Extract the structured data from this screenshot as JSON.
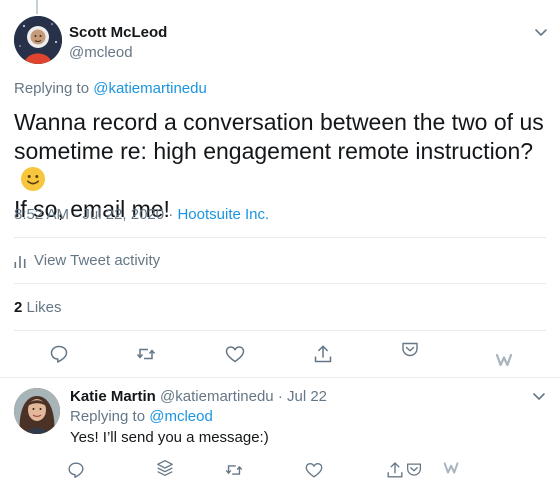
{
  "tweet": {
    "author_name": "Scott McLeod",
    "author_handle": "@mcleod",
    "replying_prefix": "Replying to ",
    "replying_to": "@katiemartinedu",
    "text_lines": [
      "Wanna record a conversation between the two of us",
      "sometime re: high engagement remote instruction?",
      "If so, email me!"
    ],
    "time": "8:52 AM",
    "date": "Jul 22, 2020",
    "separator": " · ",
    "source": "Hootsuite Inc.",
    "activity_label": "View Tweet activity",
    "likes_count": "2",
    "likes_label": " Likes"
  },
  "reply": {
    "author_name": "Katie Martin",
    "author_handle": "@katiemartinedu",
    "dot": " · ",
    "date": "Jul 22",
    "replying_prefix": "Replying to ",
    "replying_to": "@mcleod",
    "text": "Yes! I’ll send you a message:)"
  },
  "icons": {
    "reply": "reply-icon",
    "retweet": "retweet-icon",
    "like": "heart-icon",
    "share": "share-icon",
    "pocket": "pocket-icon",
    "w": "w-extension-icon",
    "layers": "layers-icon",
    "caret": "chevron-down-icon",
    "activity": "bar-chart-icon"
  },
  "colors": {
    "link": "#1b95e0",
    "secondary": "#657786",
    "text": "#14171a",
    "border": "#e6ecf0"
  }
}
